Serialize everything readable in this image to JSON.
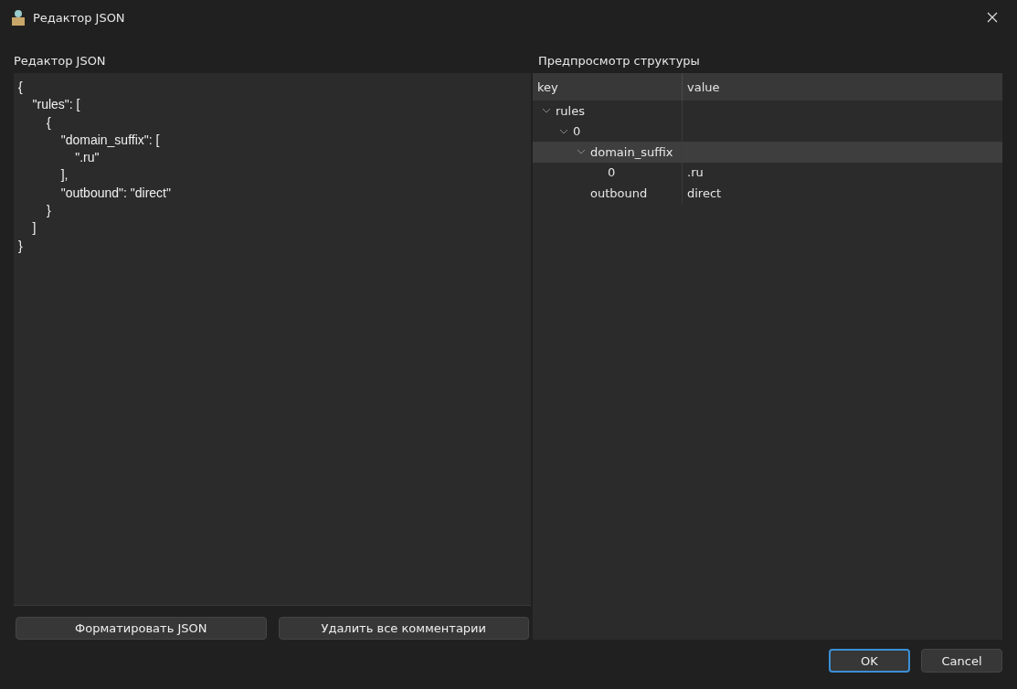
{
  "window": {
    "title": "Редактор JSON"
  },
  "editor": {
    "label": "Редактор JSON",
    "text": "{\n    \"rules\": [\n        {\n            \"domain_suffix\": [\n                \".ru\"\n            ],\n            \"outbound\": \"direct\"\n        }\n    ]\n}"
  },
  "editor_buttons": [
    "Форматировать JSON",
    "Удалить все комментарии"
  ],
  "preview": {
    "label": "Предпросмотр структуры",
    "columns": [
      "key",
      "value"
    ],
    "tree": [
      {
        "key": "rules",
        "expanded": true,
        "selected": false,
        "children": [
          {
            "key": "0",
            "expanded": true,
            "selected": false,
            "children": [
              {
                "key": "domain_suffix",
                "expanded": true,
                "selected": true,
                "children": [
                  {
                    "key": "0",
                    "value": ".ru",
                    "selected": false
                  }
                ]
              },
              {
                "key": "outbound",
                "value": "direct",
                "selected": false
              }
            ]
          }
        ]
      }
    ]
  },
  "buttons": [
    {
      "label": "OK",
      "default": true
    },
    {
      "label": "Cancel",
      "default": false
    }
  ]
}
